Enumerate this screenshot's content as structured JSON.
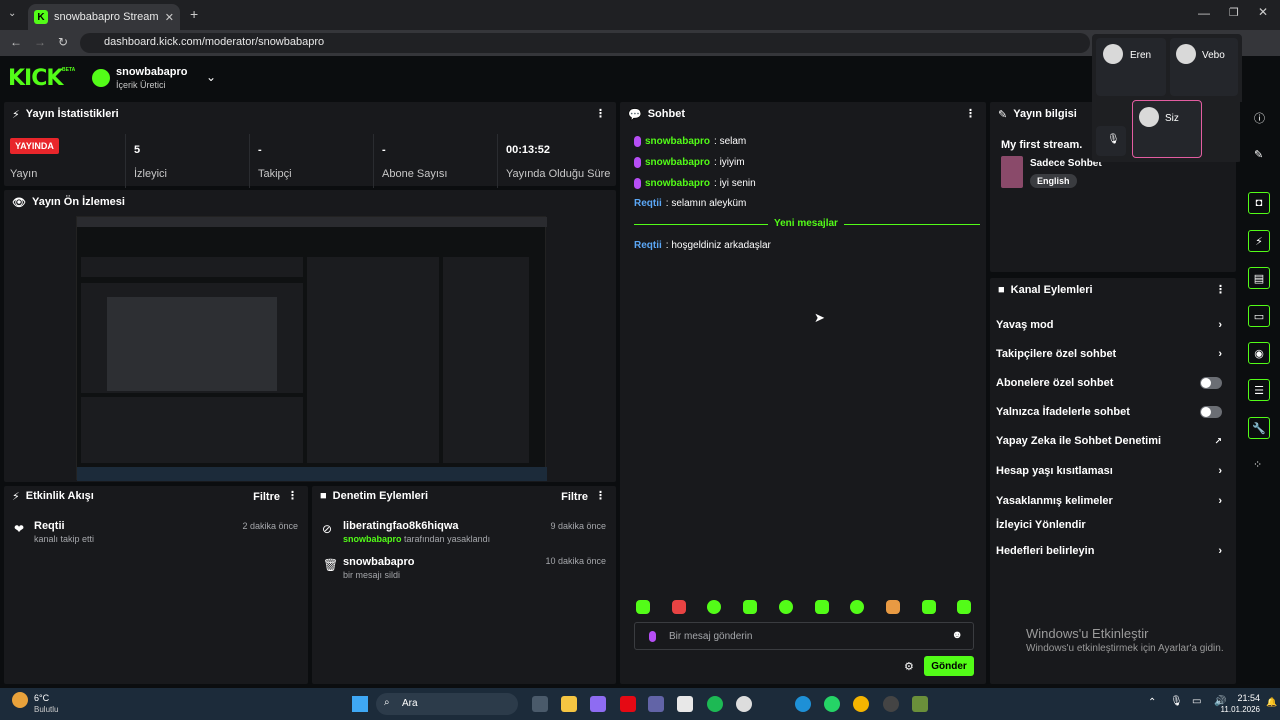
{
  "browser": {
    "tab_title": "snowbabapro Stream - Kick Da",
    "url": "dashboard.kick.com/moderator/snowbabapro"
  },
  "app": {
    "logo": "KICK",
    "beta": "BETA",
    "channel_name": "snowbabapro",
    "channel_role": "İçerik Üretici"
  },
  "stats": {
    "title": "Yayın İstatistikleri",
    "live_badge": "YAYINDA",
    "live_label": "Yayın",
    "viewers_value": "5",
    "viewers_label": "İzleyici",
    "followers_value": "-",
    "followers_label": "Takipçi",
    "subs_value": "-",
    "subs_label": "Abone Sayısı",
    "duration_value": "00:13:52",
    "duration_label": "Yayında Olduğu Süre"
  },
  "preview": {
    "title": "Yayın Ön İzlemesi"
  },
  "activity": {
    "title": "Etkinlik Akışı",
    "filter": "Filtre",
    "items": [
      {
        "user": "Reqtii",
        "text": "kanalı takip etti",
        "time": "2 dakika önce"
      }
    ]
  },
  "moderation": {
    "title": "Denetim Eylemleri",
    "filter": "Filtre",
    "items": [
      {
        "user": "liberatingfao8k6hiqwa",
        "by": "snowbabapro",
        "text": "tarafından yasaklandı",
        "time": "9 dakika önce"
      },
      {
        "user": "snowbabapro",
        "text": "bir mesajı sildi",
        "time": "10 dakika önce"
      }
    ]
  },
  "chat": {
    "title": "Sohbet",
    "messages": [
      {
        "user": "snowbabapro",
        "text": ": selam"
      },
      {
        "user": "snowbabapro",
        "text": ": iyiyim"
      },
      {
        "user": "snowbabapro",
        "text": ": iyi senin"
      },
      {
        "user": "Reqtii",
        "text": ": selamın aleyküm"
      }
    ],
    "new_divider": "Yeni mesajlar",
    "new_messages": [
      {
        "user": "Reqtii",
        "text": ": hoşgeldiniz arkadaşlar"
      }
    ],
    "input_placeholder": "Bir mesaj gönderin",
    "send": "Gönder"
  },
  "stream_info": {
    "title": "Yayın bilgisi",
    "stream_title": "My first stream.",
    "category": "Sadece Sohbet",
    "language": "English"
  },
  "voice": {
    "participants": [
      "Eren",
      "Vebo",
      "Siz"
    ]
  },
  "channel_actions": {
    "title": "Kanal Eylemleri",
    "items": [
      {
        "label": "Yavaş mod",
        "kind": "chevron"
      },
      {
        "label": "Takipçilere özel sohbet",
        "kind": "chevron"
      },
      {
        "label": "Abonelere özel sohbet",
        "kind": "toggle"
      },
      {
        "label": "Yalnızca İfadelerle sohbet",
        "kind": "toggle"
      },
      {
        "label": "Yapay Zeka ile Sohbet Denetimi",
        "kind": "external"
      },
      {
        "label": "Hesap yaşı kısıtlaması",
        "kind": "chevron"
      },
      {
        "label": "Yasaklanmış kelimeler",
        "kind": "chevron"
      },
      {
        "label": "İzleyici Yönlendir",
        "kind": "none"
      },
      {
        "label": "Hedefleri belirleyin",
        "kind": "chevron"
      }
    ]
  },
  "windows": {
    "activate_title": "Windows'u Etkinleştir",
    "activate_text": "Windows'u etkinleştirmek için Ayarlar'a gidin.",
    "weather_temp": "6°C",
    "weather_text": "Bulutlu",
    "search": "Ara",
    "time": "21:54",
    "date": "11.01.2026"
  },
  "colors": {
    "accent": "#53fc18",
    "live": "#e8262b",
    "panel": "#18191c",
    "user_green": "#53fc18",
    "user_blue": "#5ba7f6"
  }
}
